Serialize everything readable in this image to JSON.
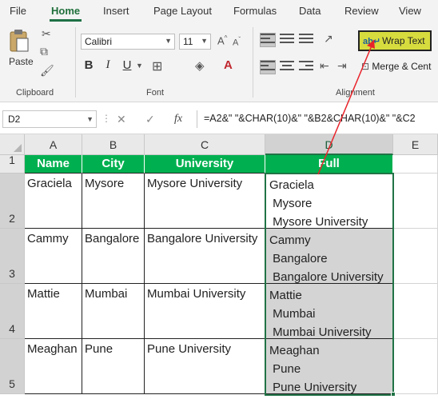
{
  "ribbon_tabs": [
    "File",
    "Home",
    "Insert",
    "Page Layout",
    "Formulas",
    "Data",
    "Review",
    "View"
  ],
  "clipboard": {
    "paste_label": "Paste",
    "group_label": "Clipboard"
  },
  "font": {
    "name": "Calibri",
    "size": "11",
    "group_label": "Font"
  },
  "alignment": {
    "wrap_text_label": "Wrap Text",
    "merge_label": "Merge & Cent",
    "group_label": "Alignment"
  },
  "formula_bar": {
    "name_box": "D2",
    "fx": "fx",
    "formula": "=A2&\" \"&CHAR(10)&\" \"&B2&CHAR(10)&\" \"&C2"
  },
  "accent_colors": {
    "header_fill": "#00b050",
    "wrap_text_highlight": "#d7dc3e",
    "arrow": "#e8232a",
    "excel_green": "#217346"
  },
  "sheet": {
    "column_headers": [
      "A",
      "B",
      "C",
      "D",
      "E"
    ],
    "row_headers": [
      "1",
      "2",
      "3",
      "4",
      "5"
    ],
    "table_headers": [
      "Name",
      "City",
      "University",
      "Full"
    ],
    "rows": [
      {
        "name": "Graciela",
        "city": "Mysore",
        "university": "Mysore University",
        "full_lines": [
          "Graciela",
          " Mysore",
          " Mysore University"
        ]
      },
      {
        "name": "Cammy",
        "city": "Bangalore",
        "university": "Bangalore University",
        "full_lines": [
          "Cammy",
          " Bangalore",
          " Bangalore University"
        ]
      },
      {
        "name": "Mattie",
        "city": "Mumbai",
        "university": "Mumbai University",
        "full_lines": [
          "Mattie",
          " Mumbai",
          " Mumbai University"
        ]
      },
      {
        "name": "Meaghan",
        "city": "Pune",
        "university": "Pune University",
        "full_lines": [
          "Meaghan",
          " Pune",
          " Pune University"
        ]
      }
    ]
  }
}
